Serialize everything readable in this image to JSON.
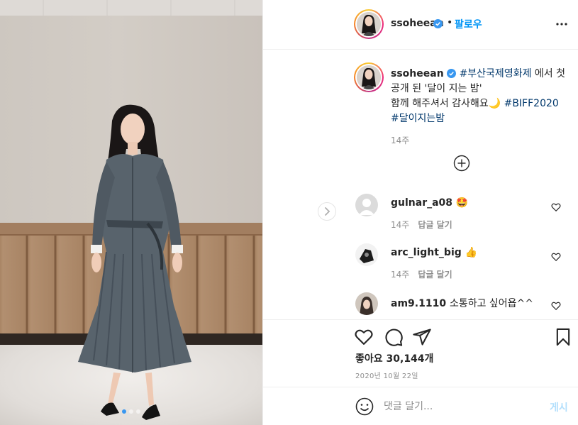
{
  "post": {
    "username": "ssoheean",
    "follow_label": "팔로우",
    "separator": "•",
    "caption": {
      "username": "ssoheean",
      "tag1": "#부산국제영화제",
      "text1": " 에서 첫 공개 된 '달이 지는 밤'",
      "text2": "함께 해주셔서 감사해요🌙 ",
      "tag2": "#BIFF2020",
      "tag3": "#달이지는밤",
      "time": "14주"
    },
    "likes_label": "좋아요 30,144개",
    "date": "2020년 10월 22일",
    "comment_placeholder": "댓글 달기...",
    "post_label": "게시"
  },
  "comments": [
    {
      "username": "gulnar_a08",
      "text": "🤩",
      "time": "14주",
      "reply": "답글 달기"
    },
    {
      "username": "arc_light_big",
      "text": "👍",
      "time": "14주",
      "reply": "답글 달기"
    },
    {
      "username": "am9.1110",
      "text": "소통하고 싶어욥^^",
      "time": "",
      "reply": ""
    }
  ],
  "carousel": {
    "count": 3,
    "active": 0
  },
  "colors": {
    "accent": "#0095f6",
    "tag": "#00376b",
    "muted": "#8e8e8e",
    "border": "#efefef"
  },
  "icons": [
    "heart-icon",
    "comment-icon",
    "share-icon",
    "bookmark-icon",
    "more-icon",
    "verified-icon",
    "plus-circle-icon",
    "emoji-icon",
    "chevron-right-icon"
  ]
}
